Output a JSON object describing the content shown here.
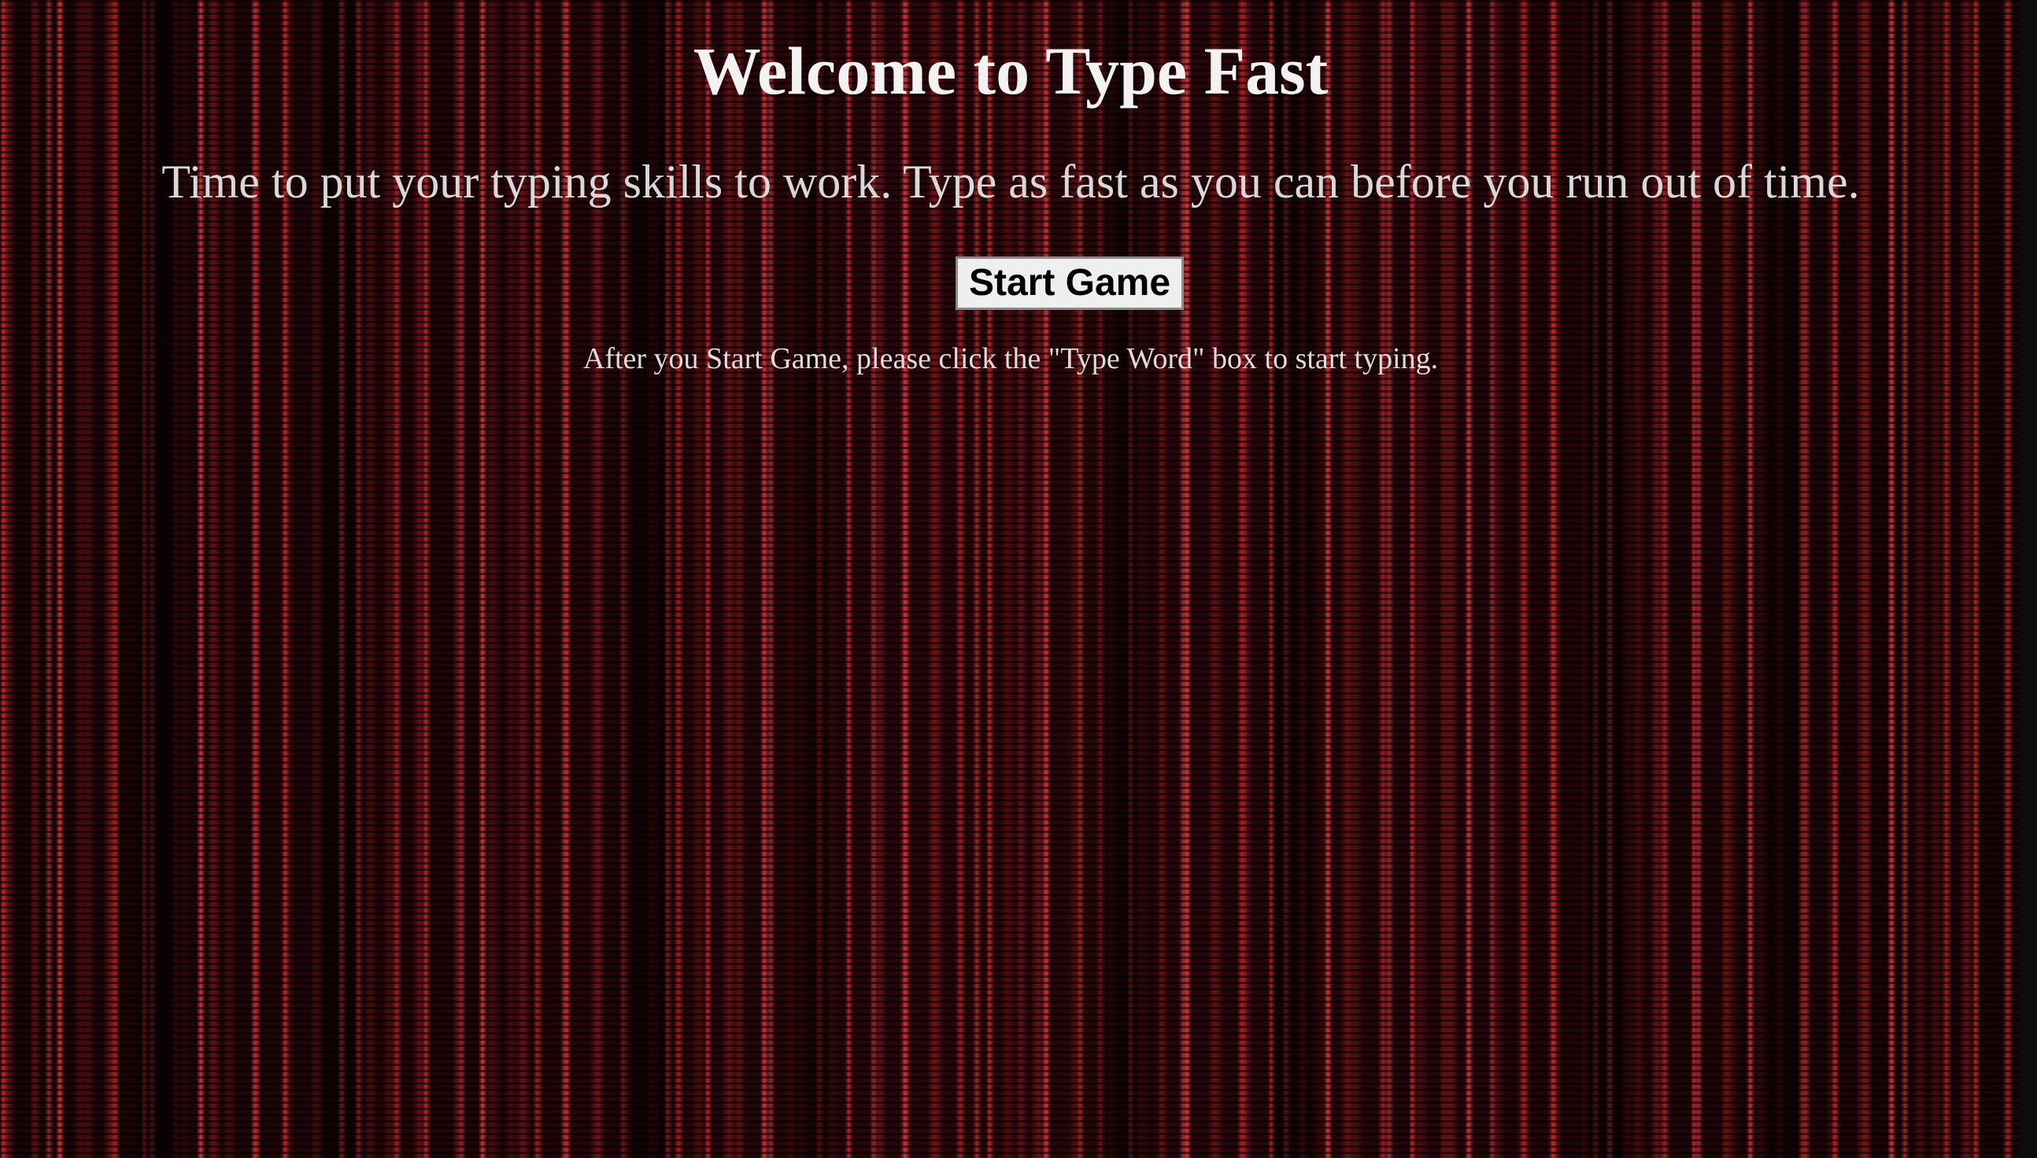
{
  "page": {
    "title": "Welcome to Type Fast",
    "subtitle": "Time to put your typing skills to work. Type as fast as you can before you run out of time.",
    "start_button_label": "Start Game",
    "hint": "After you Start Game, please click the \"Type Word\" box to start typing."
  },
  "theme": {
    "background": "#0a0203",
    "accent_red": "#dc282d",
    "text_color": "#f2f2f2",
    "button_bg": "#efefef"
  }
}
